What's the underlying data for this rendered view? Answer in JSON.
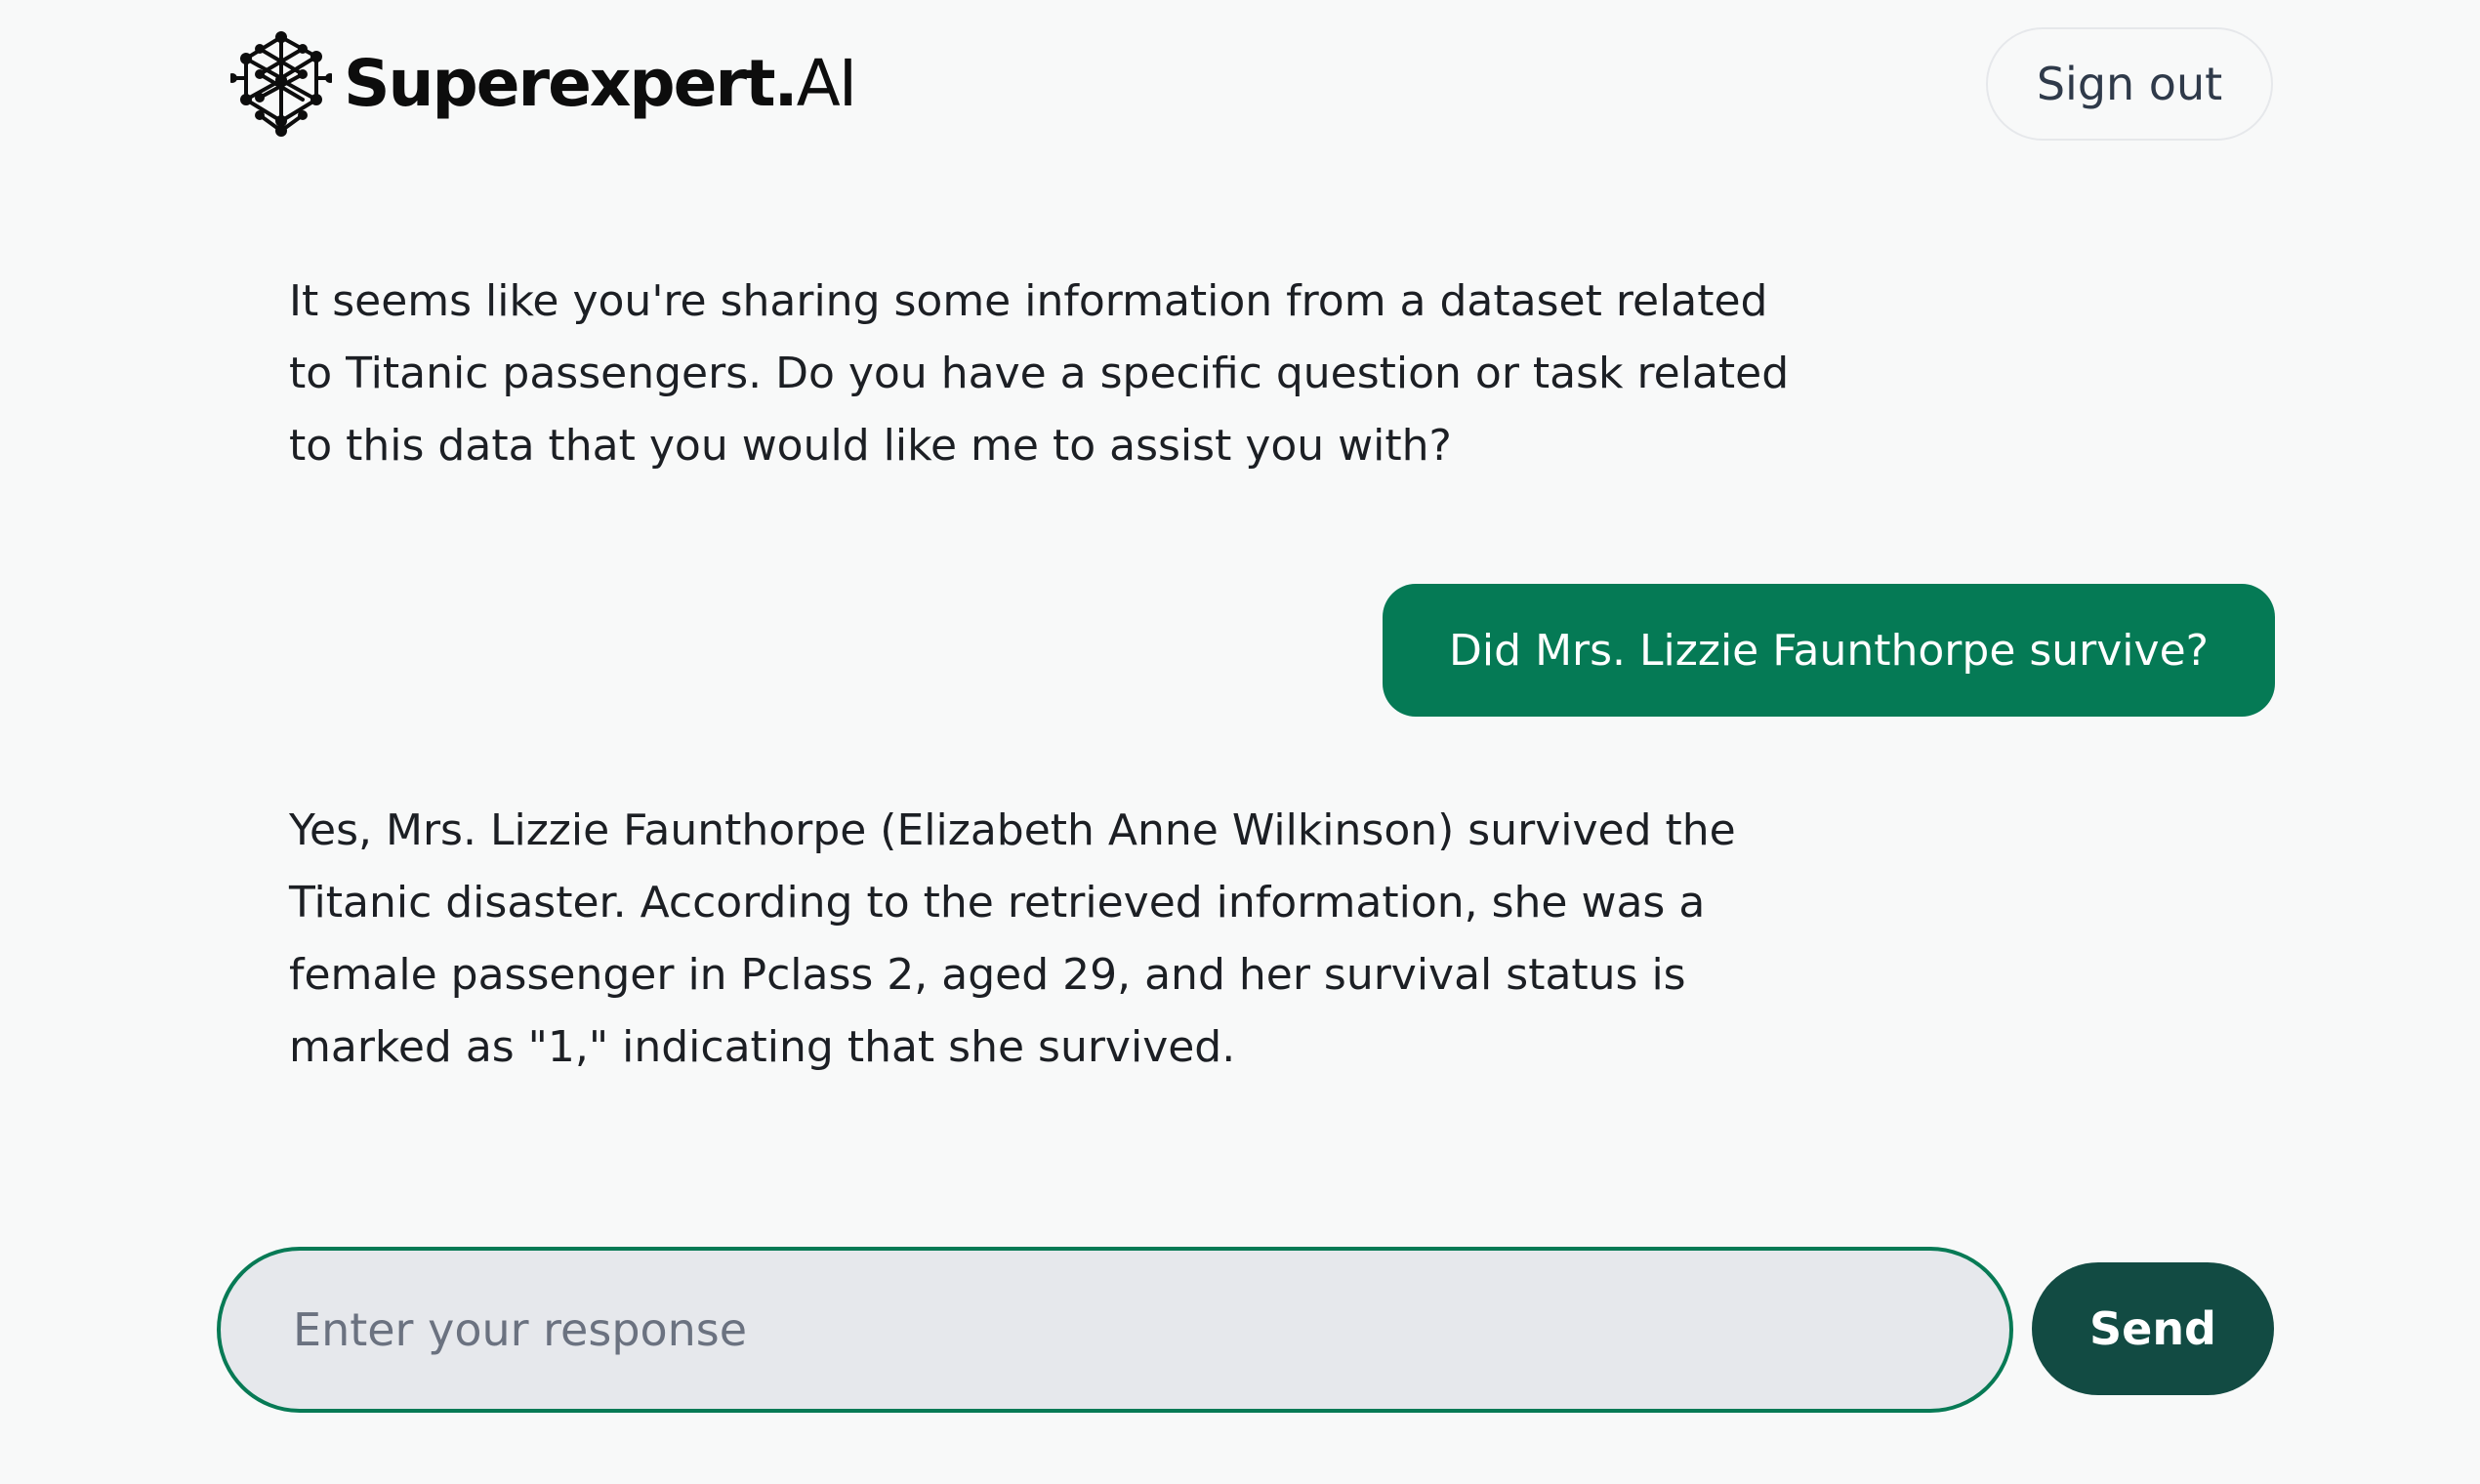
{
  "header": {
    "brand_bold": "Superexpert.",
    "brand_light": "AI",
    "logo_icon": "network-hexagon-icon",
    "signout_label": "Sign out"
  },
  "conversation": {
    "messages": [
      {
        "role": "assistant",
        "text": "It seems like you're sharing some information from a dataset related to Titanic passengers. Do you have a specific question or task related to this data that you would like me to assist you with?"
      },
      {
        "role": "user",
        "text": "Did Mrs. Lizzie Faunthorpe survive?"
      },
      {
        "role": "assistant",
        "text": "Yes, Mrs. Lizzie Faunthorpe (Elizabeth Anne Wilkinson) survived the Titanic disaster. According to the retrieved information, she was a female passenger in Pclass 2, aged 29, and her survival status is marked as \"1,\" indicating that she survived."
      }
    ]
  },
  "composer": {
    "placeholder": "Enter your response",
    "value": "",
    "send_label": "Send"
  },
  "colors": {
    "accent": "#057a55",
    "send_button": "#124b43",
    "input_border": "#077a55",
    "input_background": "#e6e8ec",
    "page_background": "#f8f9f9"
  }
}
